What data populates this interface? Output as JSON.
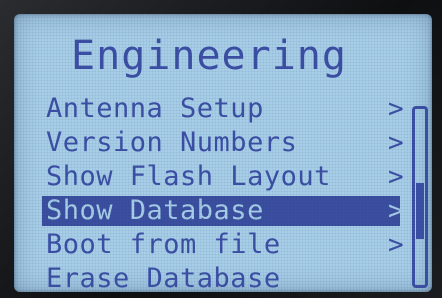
{
  "screen": {
    "title": "Engineering"
  },
  "menu": {
    "items": [
      {
        "label": "Antenna Setup",
        "chevron": ">"
      },
      {
        "label": "Version Numbers",
        "chevron": ">"
      },
      {
        "label": "Show Flash Layout",
        "chevron": ">"
      },
      {
        "label": "Show Database",
        "chevron": ">",
        "selected": true
      },
      {
        "label": "Boot from file",
        "chevron": ">"
      },
      {
        "label": "Erase Database",
        "chevron": ""
      }
    ]
  },
  "colors": {
    "lcd_background": "#a7cee8",
    "lcd_text": "#3b4fa5",
    "highlight": "#3a4fa0"
  }
}
